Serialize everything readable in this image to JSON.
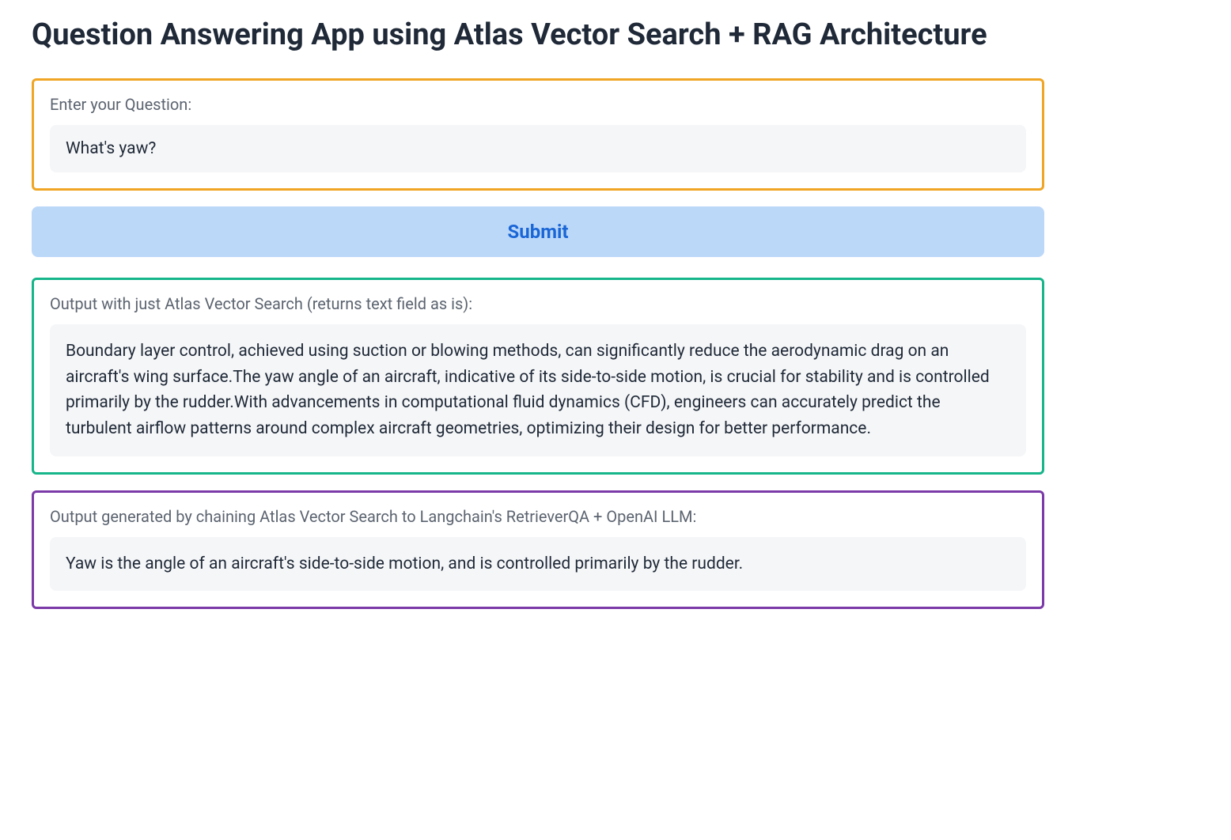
{
  "header": {
    "title": "Question Answering App using Atlas Vector Search + RAG Architecture"
  },
  "question_panel": {
    "label": "Enter your Question:",
    "value": "What's yaw?"
  },
  "submit": {
    "label": "Submit"
  },
  "vector_search_panel": {
    "label": "Output with just Atlas Vector Search (returns text field as is):",
    "value": "Boundary layer control, achieved using suction or blowing methods, can significantly reduce the aerodynamic drag on an aircraft's wing surface.The yaw angle of an aircraft, indicative of its side-to-side motion, is crucial for stability and is controlled primarily by the rudder.With advancements in computational fluid dynamics (CFD), engineers can accurately predict the turbulent airflow patterns around complex aircraft geometries, optimizing their design for better performance."
  },
  "rag_panel": {
    "label": "Output generated by chaining Atlas Vector Search to Langchain's RetrieverQA + OpenAI LLM:",
    "value": "Yaw is the angle of an aircraft's side-to-side motion, and is controlled primarily by the rudder."
  }
}
